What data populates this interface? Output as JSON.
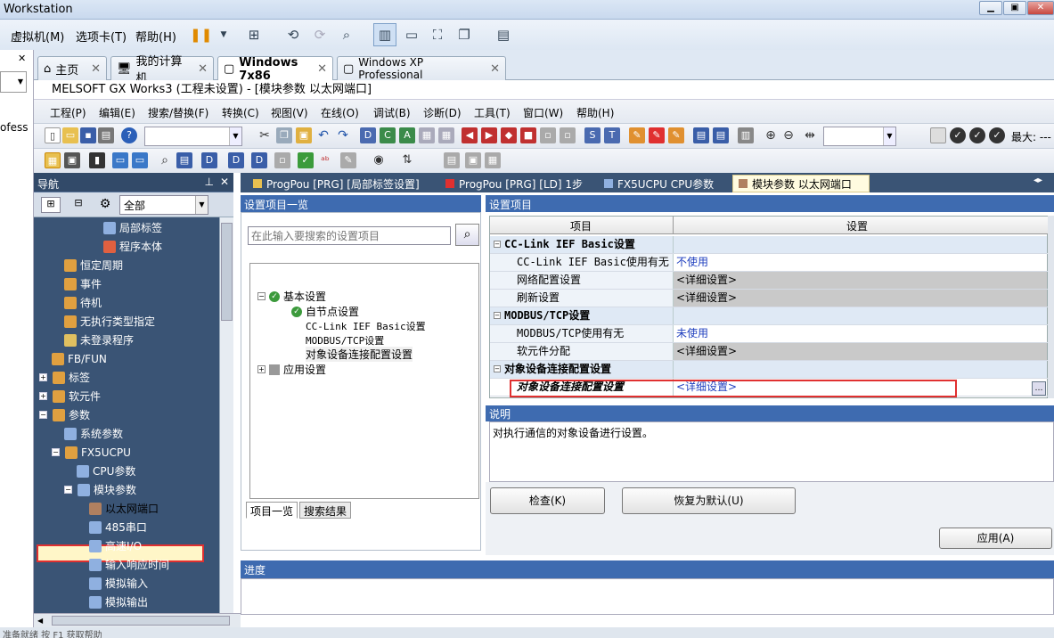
{
  "vm": {
    "title": "Workstation",
    "menus": [
      "虚拟机(M)",
      "选项卡(T)",
      "帮助(H)"
    ],
    "tabs": [
      {
        "label": "主页",
        "icon": "home-icon"
      },
      {
        "label": "我的计算机",
        "icon": "monitor-icon"
      },
      {
        "label": "Windows 7x86",
        "icon": "vm-icon",
        "active": true
      },
      {
        "label": "Windows XP Professional",
        "icon": "vm-icon"
      }
    ],
    "left_text": "ofess"
  },
  "app": {
    "title": "MELSOFT GX Works3 (工程未设置) - [模块参数 以太网端口]",
    "menus": [
      "工程(P)",
      "编辑(E)",
      "搜索/替换(F)",
      "转换(C)",
      "视图(V)",
      "在线(O)",
      "调试(B)",
      "诊断(D)",
      "工具(T)",
      "窗口(W)",
      "帮助(H)"
    ],
    "toolbar_max_label": "最大: ---"
  },
  "nav": {
    "title": "导航",
    "pin": "ᵖ",
    "filter": "全部",
    "tree": [
      {
        "label": "局部标签",
        "icon": "label-icon"
      },
      {
        "label": "程序本体",
        "icon": "program-icon"
      },
      {
        "label": "恒定周期",
        "icon": "folder-icon"
      },
      {
        "label": "事件",
        "icon": "folder-icon"
      },
      {
        "label": "待机",
        "icon": "folder-icon"
      },
      {
        "label": "无执行类型指定",
        "icon": "folder-icon"
      },
      {
        "label": "未登录程序",
        "icon": "folder-icon"
      },
      {
        "label": "FB/FUN",
        "icon": "folder-icon"
      },
      {
        "label": "标签",
        "icon": "folder-icon"
      },
      {
        "label": "软元件",
        "icon": "folder-icon"
      },
      {
        "label": "参数",
        "icon": "folder-icon"
      },
      {
        "label": "系统参数",
        "icon": "param-icon"
      },
      {
        "label": "FX5UCPU",
        "icon": "folder-icon"
      },
      {
        "label": "CPU参数",
        "icon": "param-icon"
      },
      {
        "label": "模块参数",
        "icon": "folder-icon"
      },
      {
        "label": "以太网端口",
        "icon": "network-icon"
      },
      {
        "label": "485串口",
        "icon": "param-icon"
      },
      {
        "label": "高速I/O",
        "icon": "param-icon"
      },
      {
        "label": "输入响应时间",
        "icon": "param-icon"
      },
      {
        "label": "模拟输入",
        "icon": "param-icon"
      },
      {
        "label": "模拟输出",
        "icon": "param-icon"
      }
    ]
  },
  "doc_tabs": [
    {
      "label": "ProgPou [PRG] [局部标签设置]"
    },
    {
      "label": "ProgPou [PRG] [LD] 1步"
    },
    {
      "label": "FX5UCPU CPU参数"
    },
    {
      "label": "模块参数 以太网端口",
      "active": true
    }
  ],
  "left_panel": {
    "header": "设置项目一览",
    "search_placeholder": "在此输入要搜索的设置项目",
    "tree": {
      "basic": "基本设置",
      "self_node": "自节点设置",
      "cclink": "CC-Link IEF Basic设置",
      "modbus": "MODBUS/TCP设置",
      "target": "对象设备连接配置设置",
      "app": "应用设置"
    },
    "tabs": [
      "项目一览",
      "搜索结果"
    ]
  },
  "right_panel": {
    "header": "设置项目",
    "col_item": "项目",
    "col_setting": "设置",
    "rows": [
      {
        "item": "CC-Link IEF Basic设置",
        "value": ""
      },
      {
        "item": "CC-Link IEF Basic使用有无",
        "value": "不使用"
      },
      {
        "item": "网络配置设置",
        "value": "<详细设置>"
      },
      {
        "item": "刷新设置",
        "value": "<详细设置>"
      },
      {
        "item": "MODBUS/TCP设置",
        "value": ""
      },
      {
        "item": "MODBUS/TCP使用有无",
        "value": "未使用"
      },
      {
        "item": "软元件分配",
        "value": "<详细设置>"
      },
      {
        "item": "对象设备连接配置设置",
        "value": ""
      },
      {
        "item": "对象设备连接配置设置",
        "value": "<详细设置>"
      }
    ],
    "desc_header": "说明",
    "desc_text": "对执行通信的对象设备进行设置。",
    "check_btn": "检查(K)",
    "restore_btn": "恢复为默认(U)",
    "apply_btn": "应用(A)"
  },
  "progress": {
    "header": "进度"
  },
  "status_text": "准备就绪 按 F1 获取帮助"
}
